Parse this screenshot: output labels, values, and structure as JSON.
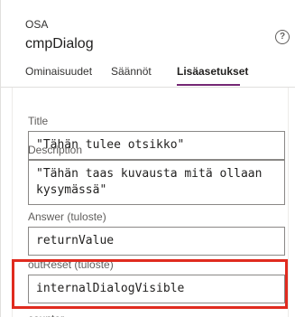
{
  "header": {
    "kicker": "OSA",
    "title": "cmpDialog",
    "help_glyph": "?"
  },
  "tabs": [
    {
      "label": "Ominaisuudet"
    },
    {
      "label": "Säännöt"
    },
    {
      "label": "Lisäasetukset",
      "active": true
    }
  ],
  "fields": [
    {
      "label": "Title",
      "value": "\"Tähän tulee otsikko\""
    },
    {
      "label": "Description",
      "value": "\"Tähän taas kuvausta mitä ollaan kysymässä\""
    },
    {
      "label": "Answer (tuloste)",
      "value": "returnValue"
    },
    {
      "label": "outReset (tuloste)",
      "value": "internalDialogVisible"
    },
    {
      "label": "counter"
    }
  ],
  "colors": {
    "accent": "#742774",
    "highlight": "#e02b1f"
  }
}
